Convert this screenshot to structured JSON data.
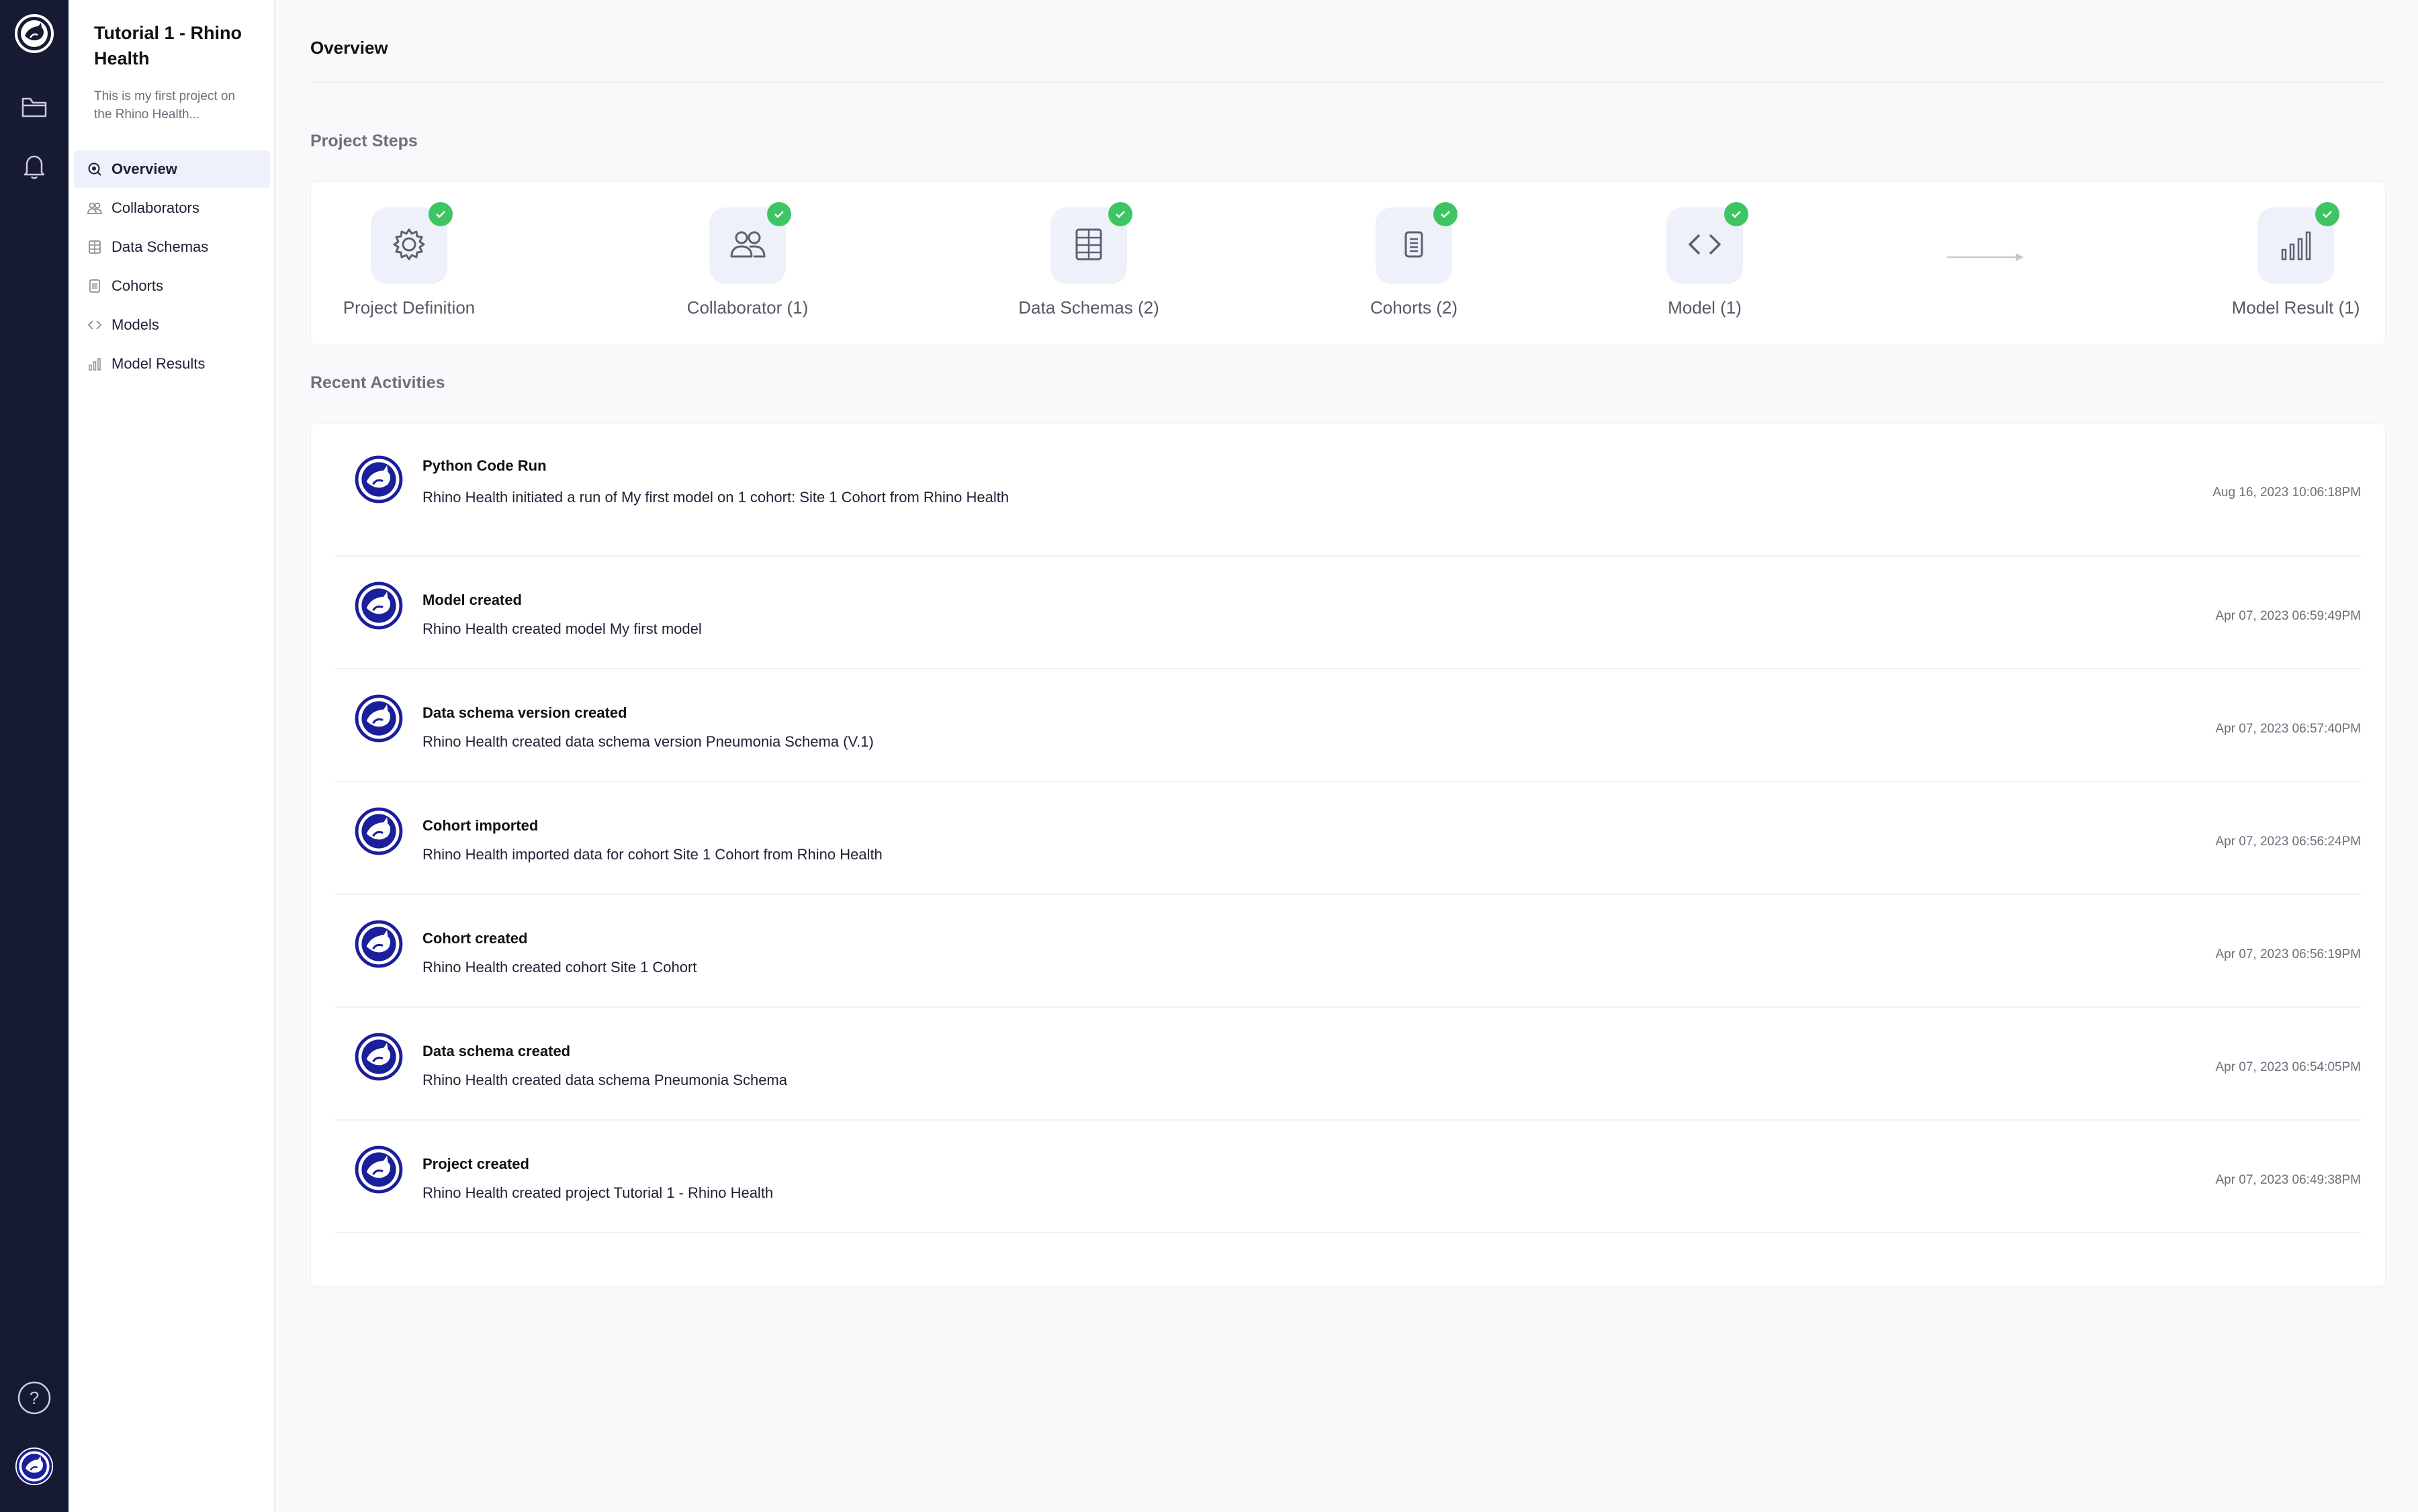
{
  "rail": {
    "items": [
      {
        "icon": "rhino-logo-icon"
      },
      {
        "icon": "folder-icon"
      },
      {
        "icon": "bell-icon"
      },
      {
        "icon": "help-icon"
      },
      {
        "icon": "user-avatar-icon"
      }
    ],
    "help_glyph": "?"
  },
  "sidebar": {
    "project_title": "Tutorial 1 - Rhino Health",
    "project_description": "This is my first project on the Rhino Health...",
    "nav": [
      {
        "label": "Overview",
        "icon": "overview-icon",
        "active": true
      },
      {
        "label": "Collaborators",
        "icon": "users-icon",
        "active": false
      },
      {
        "label": "Data Schemas",
        "icon": "table-icon",
        "active": false
      },
      {
        "label": "Cohorts",
        "icon": "document-icon",
        "active": false
      },
      {
        "label": "Models",
        "icon": "code-icon",
        "active": false
      },
      {
        "label": "Model Results",
        "icon": "bar-chart-icon",
        "active": false
      }
    ]
  },
  "main": {
    "page_title": "Overview",
    "project_steps_title": "Project Steps",
    "steps": [
      {
        "label": "Project Definition",
        "icon": "gear-icon",
        "done": true
      },
      {
        "label": "Collaborator (1)",
        "icon": "users-icon",
        "done": true
      },
      {
        "label": "Data Schemas (2)",
        "icon": "table-icon",
        "done": true
      },
      {
        "label": "Cohorts (2)",
        "icon": "document-icon",
        "done": true
      },
      {
        "label": "Model (1)",
        "icon": "code-icon",
        "done": true
      },
      {
        "label": "Model Result (1)",
        "icon": "bar-chart-icon",
        "done": true
      }
    ],
    "recent_activities_title": "Recent Activities",
    "activities": [
      {
        "title": "Python Code Run",
        "description": "Rhino Health initiated a run of My first model on 1 cohort: Site 1 Cohort from Rhino Health",
        "time": "Aug 16, 2023 10:06:18PM"
      },
      {
        "title": "Model created",
        "description": "Rhino Health created model My first model",
        "time": "Apr 07, 2023 06:59:49PM"
      },
      {
        "title": "Data schema version created",
        "description": "Rhino Health created data schema version Pneumonia Schema (V.1)",
        "time": "Apr 07, 2023 06:57:40PM"
      },
      {
        "title": "Cohort imported",
        "description": "Rhino Health imported data for cohort Site 1 Cohort from Rhino Health",
        "time": "Apr 07, 2023 06:56:24PM"
      },
      {
        "title": "Cohort created",
        "description": "Rhino Health created cohort Site 1 Cohort",
        "time": "Apr 07, 2023 06:56:19PM"
      },
      {
        "title": "Data schema created",
        "description": "Rhino Health created data schema Pneumonia Schema",
        "time": "Apr 07, 2023 06:54:05PM"
      },
      {
        "title": "Project created",
        "description": "Rhino Health created project Tutorial 1 - Rhino Health",
        "time": "Apr 07, 2023 06:49:38PM"
      }
    ]
  },
  "colors": {
    "rail_bg": "#161b33",
    "accent": "#1a1f9c",
    "check_green": "#3cc562",
    "active_nav_bg": "#eef1fb"
  }
}
